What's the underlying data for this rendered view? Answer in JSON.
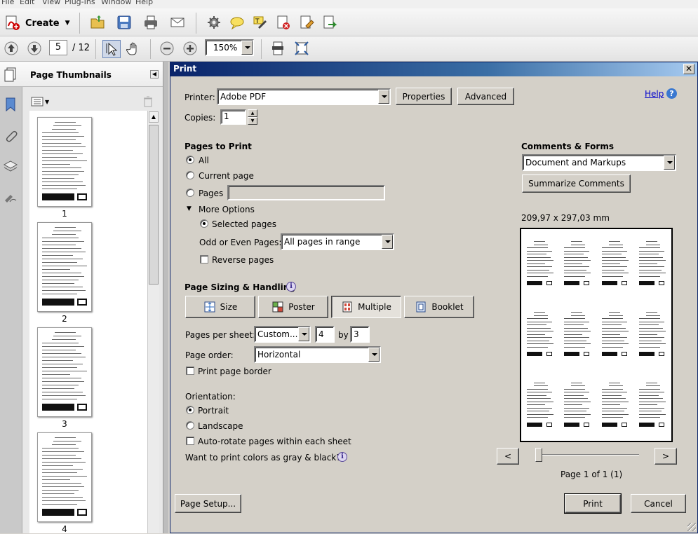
{
  "menu": [
    "File",
    "Edit",
    "View",
    "Plug-Ins",
    "Window",
    "Help"
  ],
  "toolbar": {
    "create_label": "Create",
    "icons": [
      "open-folder-icon",
      "save-icon",
      "print-icon",
      "email-icon",
      "settings-icon",
      "comment-icon",
      "highlight-icon",
      "sign-icon",
      "certify-icon",
      "review-icon"
    ]
  },
  "navigation": {
    "current_page": "5",
    "total_pages": "/ 12",
    "zoom": "150%"
  },
  "sidepanel": {
    "title": "Page Thumbnails",
    "thumbnails": [
      "1",
      "2",
      "3",
      "4"
    ]
  },
  "dialog": {
    "title": "Print",
    "close": "✕",
    "printer_label": "Printer:",
    "printer_value": "Adobe PDF",
    "properties_button": "Properties",
    "advanced_button": "Advanced",
    "help_link": "Help",
    "help_icon": "?",
    "copies_label": "Copies:",
    "copies_value": "1",
    "pages_to_print": {
      "heading": "Pages to Print",
      "all": "All",
      "current_page": "Current page",
      "pages": "Pages",
      "pages_value": "",
      "more_options": "More Options",
      "selected_pages": "Selected pages",
      "odd_even_label": "Odd or Even Pages:",
      "odd_even_value": "All pages in range",
      "reverse_pages": "Reverse pages",
      "selected": "all"
    },
    "sizing": {
      "heading": "Page Sizing & Handling",
      "size_button": "Size",
      "poster_button": "Poster",
      "multiple_button": "Multiple",
      "booklet_button": "Booklet",
      "pages_per_sheet_label": "Pages per sheet:",
      "pages_per_sheet_value": "Custom...",
      "cols": "4",
      "by_label": "by",
      "rows": "3",
      "page_order_label": "Page order:",
      "page_order_value": "Horizontal",
      "print_page_border": "Print page border"
    },
    "orientation": {
      "heading": "Orientation:",
      "portrait": "Portrait",
      "landscape": "Landscape",
      "auto_rotate": "Auto-rotate pages within each sheet",
      "gray_question": "Want to print colors as gray & black?"
    },
    "comments_forms": {
      "heading": "Comments & Forms",
      "value": "Document and Markups",
      "summarize_button": "Summarize Comments"
    },
    "preview": {
      "dimensions": "209,97 x 297,03 mm",
      "prev": "<",
      "next": ">",
      "page_info": "Page 1 of 1 (1)"
    },
    "page_setup_button": "Page Setup...",
    "print_button": "Print",
    "cancel_button": "Cancel"
  }
}
